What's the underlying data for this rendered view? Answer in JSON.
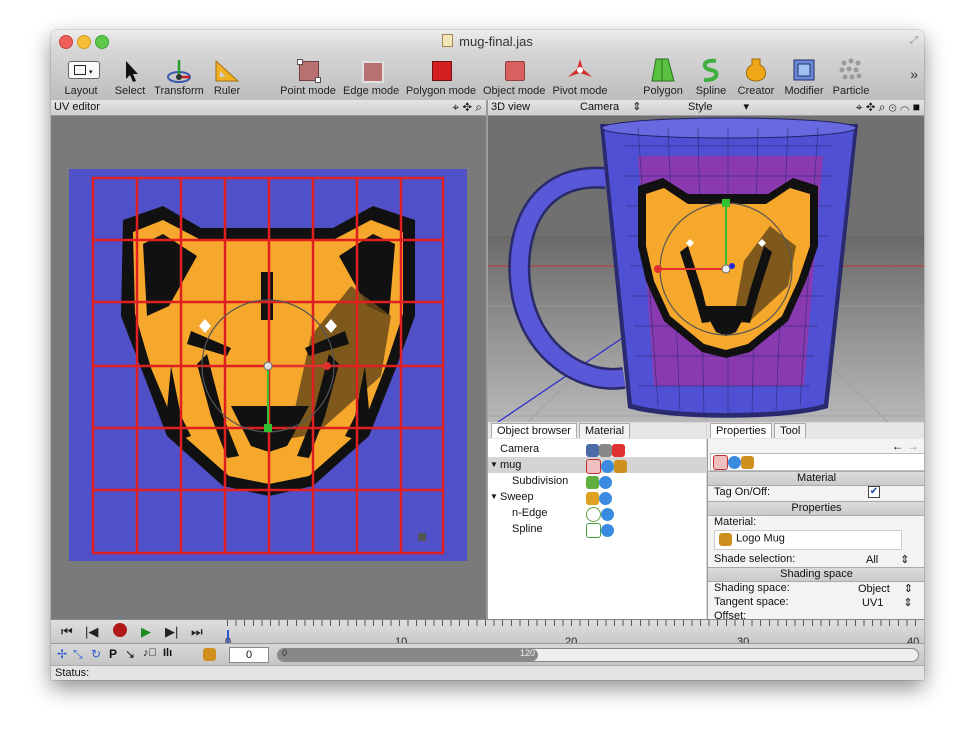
{
  "window": {
    "title": "mug-final.jas"
  },
  "toolbar": {
    "tools": [
      {
        "label": "Layout",
        "icon": "layout-icon"
      },
      {
        "label": "Select",
        "icon": "select-arrow-icon"
      },
      {
        "label": "Transform",
        "icon": "transform-icon"
      },
      {
        "label": "Ruler",
        "icon": "ruler-icon"
      },
      {
        "label": "Point mode",
        "icon": "point-mode-icon"
      },
      {
        "label": "Edge mode",
        "icon": "edge-mode-icon"
      },
      {
        "label": "Polygon mode",
        "icon": "polygon-mode-icon"
      },
      {
        "label": "Object mode",
        "icon": "object-mode-icon"
      },
      {
        "label": "Pivot mode",
        "icon": "pivot-mode-icon"
      },
      {
        "label": "Polygon",
        "icon": "polygon-icon"
      },
      {
        "label": "Spline",
        "icon": "spline-icon"
      },
      {
        "label": "Creator",
        "icon": "creator-icon"
      },
      {
        "label": "Modifier",
        "icon": "modifier-icon"
      },
      {
        "label": "Particle",
        "icon": "particle-icon"
      }
    ],
    "more": "»"
  },
  "uv_editor": {
    "title": "UV editor"
  },
  "view3d": {
    "title": "3D view",
    "camera": "Camera",
    "style": "Style"
  },
  "object_browser": {
    "tabs": [
      "Object browser",
      "Material"
    ],
    "items": [
      "Camera",
      "mug",
      "Subdivision",
      "Sweep",
      "n-Edge",
      "Spline"
    ]
  },
  "properties": {
    "tabs": [
      "Properties",
      "Tool"
    ],
    "material_section": "Material",
    "tag_label": "Tag On/Off:",
    "properties_section": "Properties",
    "material_label": "Material:",
    "material_value": "Logo Mug",
    "shade_selection_label": "Shade selection:",
    "shade_selection_value": "All",
    "shading_section": "Shading space",
    "shading_space_label": "Shading space:",
    "shading_space_value": "Object",
    "tangent_space_label": "Tangent space:",
    "tangent_space_value": "UV1",
    "offset_label": "Offset:"
  },
  "timeline": {
    "ticks": [
      "0",
      "10",
      "20",
      "30",
      "40"
    ]
  },
  "bottom": {
    "frame_value": "0",
    "range_start": "0",
    "range_end": "120"
  },
  "status": {
    "label": "Status:"
  },
  "colors": {
    "accent_red": "#d42020",
    "uv_bg": "#5050c8",
    "mug_blue": "#4a4ad0",
    "logo_orange": "#f5a82c"
  }
}
